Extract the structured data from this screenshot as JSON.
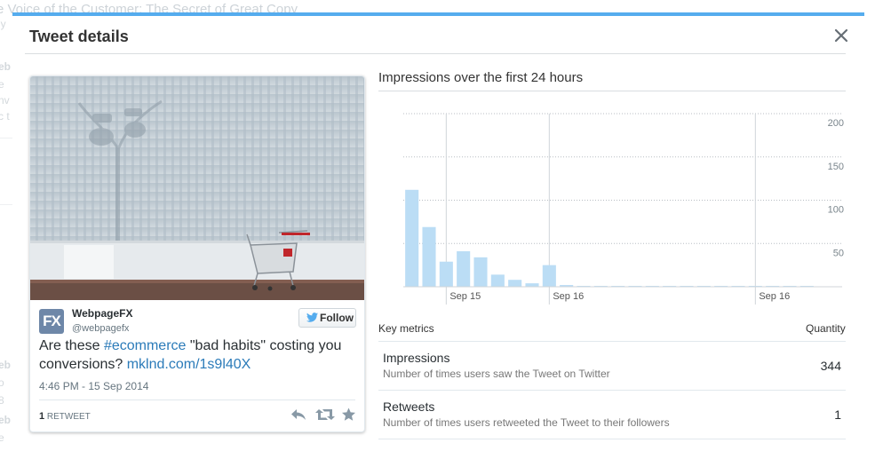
{
  "background_page": {
    "article_title_fragment": "e Voice of the Customer: The Secret of Great Copy"
  },
  "modal": {
    "title": "Tweet details"
  },
  "tweet": {
    "author_name": "WebpageFX",
    "author_handle": "@webpagefx",
    "avatar_text": "FX",
    "follow_label": "Follow",
    "text_before": "Are these ",
    "hashtag": "#ecommerce",
    "text_middle": " \"bad habits\" costing you conversions? ",
    "link": "mklnd.com/1s9l40X",
    "timestamp": "4:46 PM - 15 Sep 2014",
    "retweet_count": "1",
    "retweet_label": "RETWEET",
    "actions": [
      "reply-icon",
      "retweet-icon",
      "favorite-icon"
    ]
  },
  "chart": {
    "title": "Impressions over the first 24 hours"
  },
  "chart_data": {
    "type": "bar",
    "title": "Impressions over the first 24 hours",
    "ylim": [
      0,
      200
    ],
    "yticks": [
      50,
      100,
      150,
      200
    ],
    "y_axis_position": "right",
    "grid": true,
    "bar_color": "#bbddf5",
    "x_tick_labels": [
      {
        "label": "Sep 15",
        "bar_index": 2.5
      },
      {
        "label": "Sep 16",
        "bar_index": 8.5
      },
      {
        "label": "Sep 16",
        "bar_index": 20.5
      }
    ],
    "values": [
      112,
      69,
      29,
      41,
      34,
      14,
      8,
      4,
      25,
      2,
      1,
      1,
      1,
      1,
      1,
      1,
      1,
      1,
      1,
      1,
      1,
      1,
      1,
      1
    ]
  },
  "metrics": {
    "header_label": "Key metrics",
    "header_quantity": "Quantity",
    "rows": [
      {
        "name": "Impressions",
        "description": "Number of times users saw the Tweet on Twitter",
        "value": "344"
      },
      {
        "name": "Retweets",
        "description": "Number of times users retweeted the Tweet to their followers",
        "value": "1"
      }
    ]
  },
  "colors": {
    "accent": "#55acee",
    "link": "#2b7bb9",
    "avatar": "#6e87a8"
  }
}
